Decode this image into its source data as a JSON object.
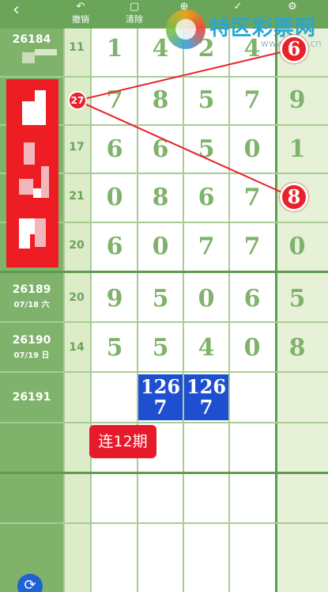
{
  "toolbar": {
    "back_icon": "chevron-left-icon",
    "items": [
      {
        "label": "撤销",
        "icon": "undo-icon",
        "glyph": "↶"
      },
      {
        "label": "清除",
        "icon": "trash-icon",
        "glyph": "🗑"
      },
      {
        "label": "",
        "icon": "add-icon",
        "glyph": "⊕"
      },
      {
        "label": "",
        "icon": "check-icon",
        "glyph": "✓"
      },
      {
        "label": "",
        "icon": "settings-icon",
        "glyph": "⚙"
      }
    ]
  },
  "watermark": {
    "name": "特区彩票网",
    "url": "www.tqcp.cn"
  },
  "rows": [
    {
      "issue": "26184",
      "date": "",
      "sum": "11",
      "digits": [
        "1",
        "4",
        "2",
        "4"
      ],
      "extra": ""
    },
    {
      "issue": "",
      "date": "",
      "sum": "27",
      "digits": [
        "7",
        "8",
        "5",
        "7"
      ],
      "extra": "9"
    },
    {
      "issue": "",
      "date": "",
      "sum": "17",
      "digits": [
        "6",
        "6",
        "5",
        "0"
      ],
      "extra": "1"
    },
    {
      "issue": "",
      "date": "",
      "sum": "21",
      "digits": [
        "0",
        "8",
        "6",
        "7"
      ],
      "extra": ""
    },
    {
      "issue": "",
      "date": "",
      "sum": "20",
      "digits": [
        "6",
        "0",
        "7",
        "7"
      ],
      "extra": "0"
    },
    {
      "issue": "26189",
      "date": "07/18 六",
      "sum": "20",
      "digits": [
        "9",
        "5",
        "0",
        "6"
      ],
      "extra": "5"
    },
    {
      "issue": "26190",
      "date": "07/19 日",
      "sum": "14",
      "digits": [
        "5",
        "5",
        "4",
        "0"
      ],
      "extra": "8"
    },
    {
      "issue": "26191",
      "date": "",
      "sum": "",
      "digits": [
        "",
        "",
        "",
        ""
      ],
      "extra": ""
    }
  ],
  "markers": {
    "circle_top": "6",
    "circle_mid": "8",
    "circle_sum": "27"
  },
  "prediction": {
    "box1": "126\n7",
    "box2": "126\n7",
    "box1_line1": "126",
    "box1_line2": "7",
    "box2_line1": "126",
    "box2_line2": "7"
  },
  "badge": "连12期",
  "colors": {
    "green": "#7fb26a",
    "red": "#e8222b",
    "blue": "#1f4fd1"
  }
}
